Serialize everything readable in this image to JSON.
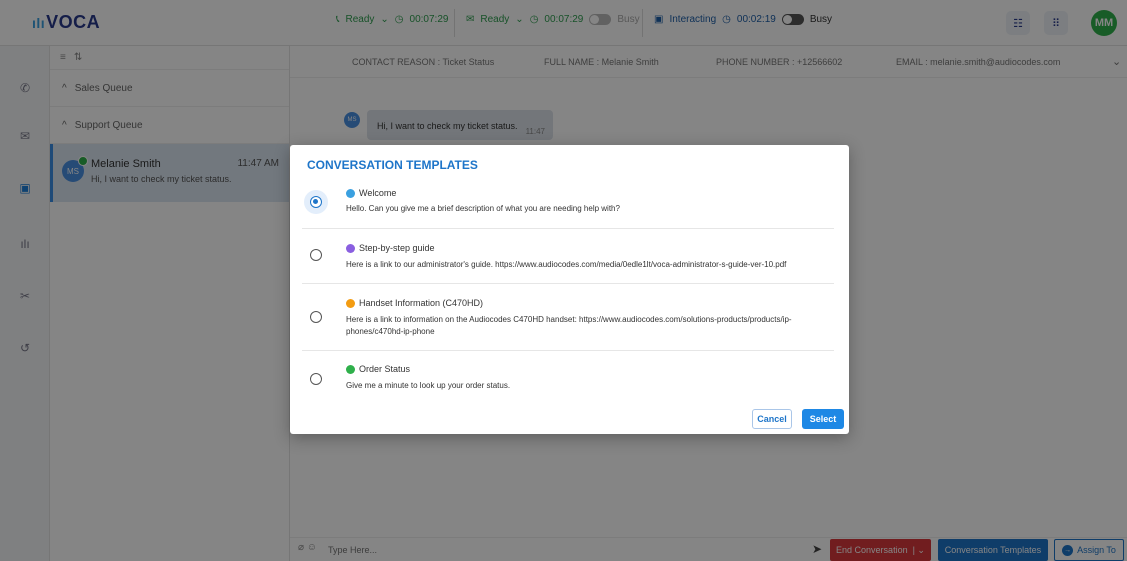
{
  "app": {
    "logo_text": "VOCA"
  },
  "topbar": {
    "voice": {
      "state": "Ready",
      "timer": "00:07:29"
    },
    "chat": {
      "state": "Ready",
      "timer": "00:07:29",
      "toggle_label": "Busy"
    },
    "interacting": {
      "label": "Interacting",
      "timer": "00:02:19",
      "toggle_label": "Busy"
    },
    "user_initials": "MM"
  },
  "rail": {
    "icons": [
      "phone-icon",
      "mail-icon",
      "chat-icon",
      "chart-icon",
      "contacts-icon",
      "history-icon"
    ]
  },
  "queues": [
    {
      "label": "Sales Queue"
    },
    {
      "label": "Support Queue"
    }
  ],
  "conversation": {
    "initials": "MS",
    "name": "Melanie Smith",
    "time": "11:47 AM",
    "preview": "Hi, I want to check my ticket status."
  },
  "contact": {
    "reason": "CONTACT REASON : Ticket Status",
    "full_name": "FULL NAME : Melanie Smith",
    "phone": "PHONE NUMBER : +12566602",
    "email": "EMAIL : melanie.smith@audiocodes.com"
  },
  "message": {
    "initials": "MS",
    "text": "Hi, I want to check my ticket status.",
    "time": "11:47"
  },
  "composer": {
    "placeholder": "Type Here...",
    "end_label": "End Conversation",
    "templates_label": "Conversation Templates",
    "assign_label": "Assign To"
  },
  "modal": {
    "title": "CONVERSATION TEMPLATES",
    "templates": [
      {
        "name": "Welcome",
        "text": "Hello. Can you give me a brief description of what you are needing help with?",
        "color": "#3aa0e0",
        "selected": true
      },
      {
        "name": "Step-by-step guide",
        "text": "Here is a link to our administrator's guide. https://www.audiocodes.com/media/0edle1lt/voca-administrator-s-guide-ver-10.pdf",
        "color": "#8a5fe0",
        "selected": false
      },
      {
        "name": "Handset Information (C470HD)",
        "text": "Here is a link to information on the Audiocodes C470HD handset: https://www.audiocodes.com/solutions-products/products/ip-phones/c470hd-ip-phone",
        "color": "#f39c12",
        "selected": false
      },
      {
        "name": "Order Status",
        "text": "Give me a minute to look up your order status.",
        "color": "#2fb04b",
        "selected": false
      }
    ],
    "cancel_label": "Cancel",
    "select_label": "Select"
  },
  "colors": {
    "accent": "#1e75c9",
    "danger": "#d9393c",
    "ready": "#2e9e4f"
  }
}
